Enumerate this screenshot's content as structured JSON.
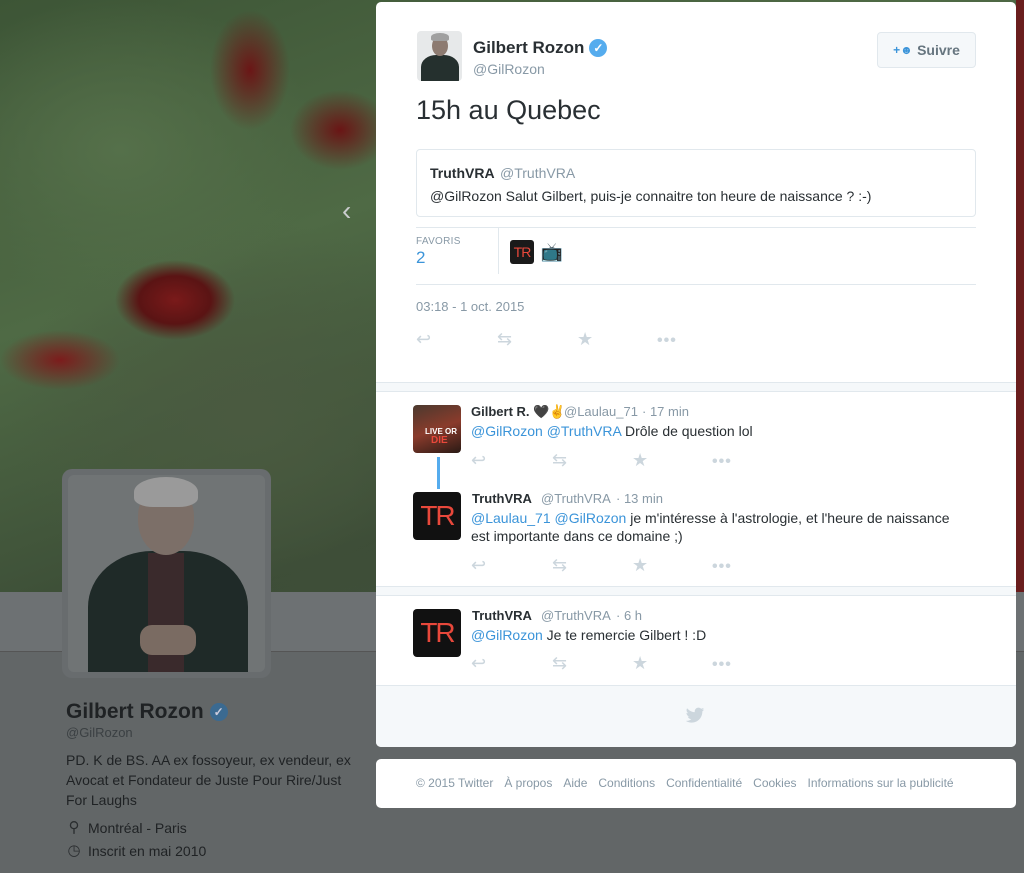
{
  "profile": {
    "name": "Gilbert Rozon",
    "handle": "@GilRozon",
    "bio": "PD. K de BS. AA ex fossoyeur, ex vendeur, ex Avocat et Fondateur de Juste Pour Rire/Just For Laughs",
    "location": "Montréal - Paris",
    "joined": "Inscrit en mai 2010"
  },
  "tweet": {
    "author_name": "Gilbert Rozon",
    "author_handle": "@GilRozon",
    "follow_label": "Suivre",
    "text": "15h au Quebec",
    "quoted": {
      "name": "TruthVRA",
      "handle": "@TruthVRA",
      "text": "@GilRozon Salut Gilbert, puis-je connaitre ton heure de naissance ? :-)"
    },
    "favorites_label": "FAVORIS",
    "favorites_count": "2",
    "timestamp": "03:18 - 1 oct. 2015"
  },
  "replies": [
    {
      "name": "Gilbert R. 🖤✌",
      "handle": "@Laulau_71",
      "time": "· 17 min",
      "mention1": "@GilRozon",
      "mention2": "@TruthVRA",
      "text": " Drôle de question lol",
      "avatar_text_1": "LIVE OR",
      "avatar_text_2": "DIE"
    },
    {
      "name": "TruthVRA",
      "handle": "@TruthVRA",
      "time": "· 13 min",
      "mention1": "@Laulau_71",
      "mention2": "@GilRozon",
      "text": " je m'intéresse à l'astrologie, et l'heure de naissance est importante dans ce domaine ;)",
      "avatar_text": "TR"
    },
    {
      "name": "TruthVRA",
      "handle": "@TruthVRA",
      "time": "· 6 h",
      "mention1": "@GilRozon",
      "text": " Je te remercie Gilbert ! :D",
      "avatar_text": "TR"
    }
  ],
  "footer": {
    "links": [
      "© 2015 Twitter",
      "À propos",
      "Aide",
      "Conditions",
      "Confidentialité",
      "Cookies",
      "Informations sur la publicité"
    ]
  },
  "icons": {
    "reply": "↩",
    "retweet": "⇆",
    "favorite": "★",
    "more": "•••",
    "bird": "🐦",
    "verified": "✓",
    "location": "📍",
    "calendar": "🕓",
    "nav_prev": "‹"
  },
  "colors": {
    "accent": "#3b94d9",
    "verified": "#55acee",
    "muted": "#8899a6"
  }
}
